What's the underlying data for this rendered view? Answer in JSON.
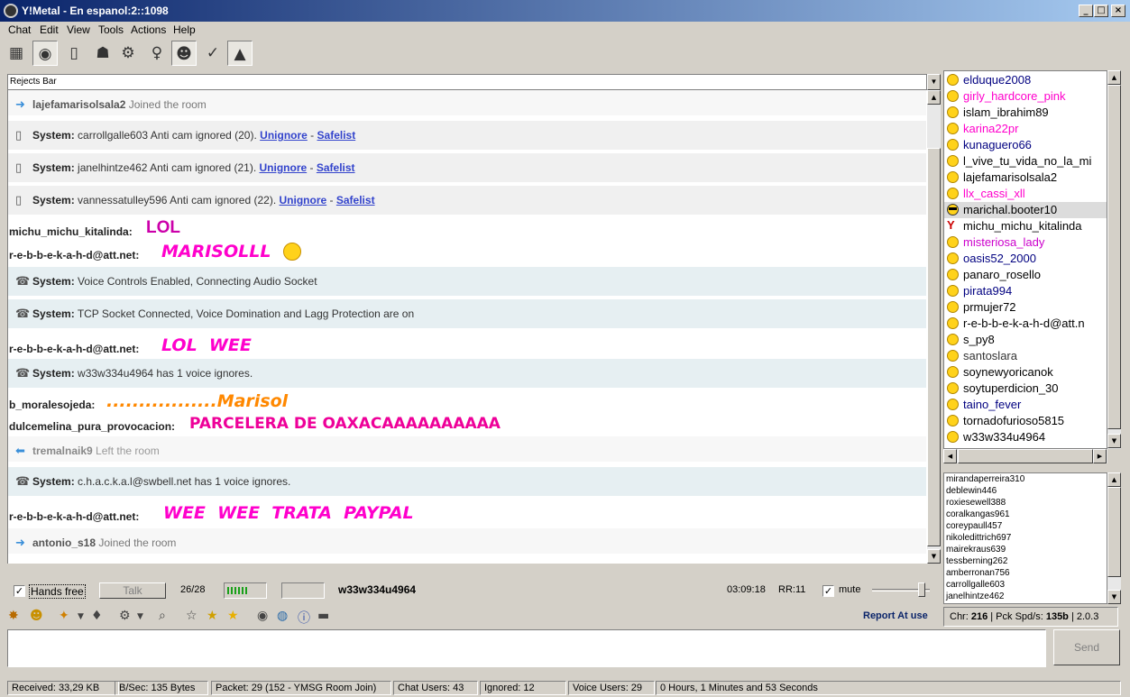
{
  "window": {
    "title": "Y!Metal - En espanol:2::1098",
    "controls": [
      "_",
      "□",
      "×"
    ]
  },
  "menu": [
    "Chat",
    "Edit",
    "View",
    "Tools",
    "Actions",
    "Help"
  ],
  "rejects_bar": {
    "label": "Rejects Bar"
  },
  "chat": {
    "messages": [
      {
        "kind": "join",
        "nick": "lajefamarisolsala2",
        "text": "Joined the room"
      },
      {
        "kind": "sys",
        "label": "System:",
        "text": "carrollgalle603 Anti cam ignored (20).",
        "link1": "Unignore",
        "sep": "-",
        "link2": "Safelist"
      },
      {
        "kind": "sys",
        "label": "System:",
        "text": "janelhintze462 Anti cam ignored (21).",
        "link1": "Unignore",
        "sep": "-",
        "link2": "Safelist"
      },
      {
        "kind": "sys",
        "label": "System:",
        "text": "vannessatulley596 Anti cam ignored (22).",
        "link1": "Unignore",
        "sep": "-",
        "link2": "Safelist"
      },
      {
        "kind": "user",
        "nick": "michu_michu_kitalinda:",
        "text": "LOL",
        "color": "#cc00aa"
      },
      {
        "kind": "user",
        "nick": "r-e-b-b-e-k-a-h-d@att.net:",
        "text": "MARISOLLL",
        "color": "#ff00cc"
      },
      {
        "kind": "voice",
        "label": "System:",
        "text": "Voice Controls Enabled, Connecting Audio Socket"
      },
      {
        "kind": "voice",
        "label": "System:",
        "text": "TCP Socket Connected, Voice Domination and Lagg Protection are on"
      },
      {
        "kind": "user",
        "nick": "r-e-b-b-e-k-a-h-d@att.net:",
        "text": "LOL  WEE",
        "color": "#ff00cc"
      },
      {
        "kind": "voice",
        "label": "System:",
        "text": "w33w334u4964 has 1 voice ignores."
      },
      {
        "kind": "user",
        "nick": "b_moralesojeda:",
        "text": ".................Marisol",
        "color": "#ff8800"
      },
      {
        "kind": "user",
        "nick": "dulcemelina_pura_provocacion:",
        "text": "PARCELERA DE OAXACAAAAAAAAAA",
        "color": "#ee0099"
      },
      {
        "kind": "leave",
        "nick": "tremalnaik9",
        "text": "Left the room"
      },
      {
        "kind": "voice",
        "label": "System:",
        "text": "c.h.a.c.k.a.l@swbell.net has 1 voice ignores."
      },
      {
        "kind": "user",
        "nick": "r-e-b-b-e-k-a-h-d@att.net:",
        "text": "WEE  WEE  TRATA  PAYPAL",
        "color": "#ff00cc"
      },
      {
        "kind": "join",
        "nick": "antonio_s18",
        "text": "Joined the room"
      }
    ]
  },
  "userlist": [
    {
      "name": "elduque2008",
      "color": "#000080",
      "icon": "smiley-icon"
    },
    {
      "name": "girly_hardcore_pink",
      "color": "#ff00cc",
      "icon": "smiley-icon"
    },
    {
      "name": "islam_ibrahim89",
      "color": "#000000",
      "icon": "smiley-icon"
    },
    {
      "name": "karina22pr",
      "color": "#ff00cc",
      "icon": "smiley-icon"
    },
    {
      "name": "kunaguero66",
      "color": "#000080",
      "icon": "smiley-icon"
    },
    {
      "name": "l_vive_tu_vida_no_la_mi",
      "color": "#000000",
      "icon": "smiley-icon"
    },
    {
      "name": "lajefamarisolsala2",
      "color": "#000000",
      "icon": "smiley-icon"
    },
    {
      "name": "llx_cassi_xll",
      "color": "#ff00cc",
      "icon": "smiley-icon"
    },
    {
      "name": "marichal.booter10",
      "color": "#000000",
      "icon": "cool-smiley-icon",
      "selected": true
    },
    {
      "name": "michu_michu_kitalinda",
      "color": "#000000",
      "icon": "yahoo-y-icon"
    },
    {
      "name": "misteriosa_lady",
      "color": "#cc00cc",
      "icon": "smiley-icon"
    },
    {
      "name": "oasis52_2000",
      "color": "#000080",
      "icon": "smiley-icon"
    },
    {
      "name": "panaro_rosello",
      "color": "#000000",
      "icon": "smiley-icon"
    },
    {
      "name": "pirata994",
      "color": "#000080",
      "icon": "smiley-icon"
    },
    {
      "name": "prmujer72",
      "color": "#000000",
      "icon": "smiley-icon"
    },
    {
      "name": "r-e-b-b-e-k-a-h-d@att.n",
      "color": "#000000",
      "icon": "smiley-icon"
    },
    {
      "name": "s_py8",
      "color": "#000000",
      "icon": "smiley-icon"
    },
    {
      "name": "santoslara",
      "color": "#333333",
      "icon": "smiley-icon"
    },
    {
      "name": "soynewyoricanok",
      "color": "#000000",
      "icon": "smiley-icon"
    },
    {
      "name": "soytuperdicion_30",
      "color": "#000000",
      "icon": "smiley-icon"
    },
    {
      "name": "taino_fever",
      "color": "#000080",
      "icon": "smiley-icon"
    },
    {
      "name": "tornadofurioso5815",
      "color": "#000000",
      "icon": "smiley-icon"
    },
    {
      "name": "w33w334u4964",
      "color": "#000000",
      "icon": "smiley-icon"
    }
  ],
  "voicelist": [
    "mirandaperreira310",
    "deblewin446",
    "roxiesewell388",
    "coralkangas961",
    "coreypaull457",
    "nikoledittrich697",
    "mairekraus639",
    "tessberning262",
    "amberronan756",
    "carrollgalle603",
    "janelhintze462"
  ],
  "voice_controls": {
    "hands_free": "Hands free",
    "hands_free_checked": true,
    "talk": "Talk",
    "count": "26/28",
    "current_user": "w33w334u4964",
    "time": "03:09:18",
    "rr": "RR:11",
    "mute": "mute",
    "mute_checked": true
  },
  "report": "Report At use",
  "chr_info": {
    "chr_label": "Chr:",
    "chr": "216",
    "pck_label": "| Pck Spd/s:",
    "pck": "135b",
    "version": "| 2.0.3"
  },
  "send": "Send",
  "status": {
    "received": "Received: 33,29 KB",
    "bsec": "B/Sec: 135 Bytes",
    "packet": "Packet: 29 (152 - YMSG Room Join)",
    "chat_users": "Chat Users: 43",
    "ignored": "Ignored: 12",
    "voice_users": "Voice Users: 29",
    "uptime": "0  Hours,  1  Minutes and  53  Seconds"
  }
}
